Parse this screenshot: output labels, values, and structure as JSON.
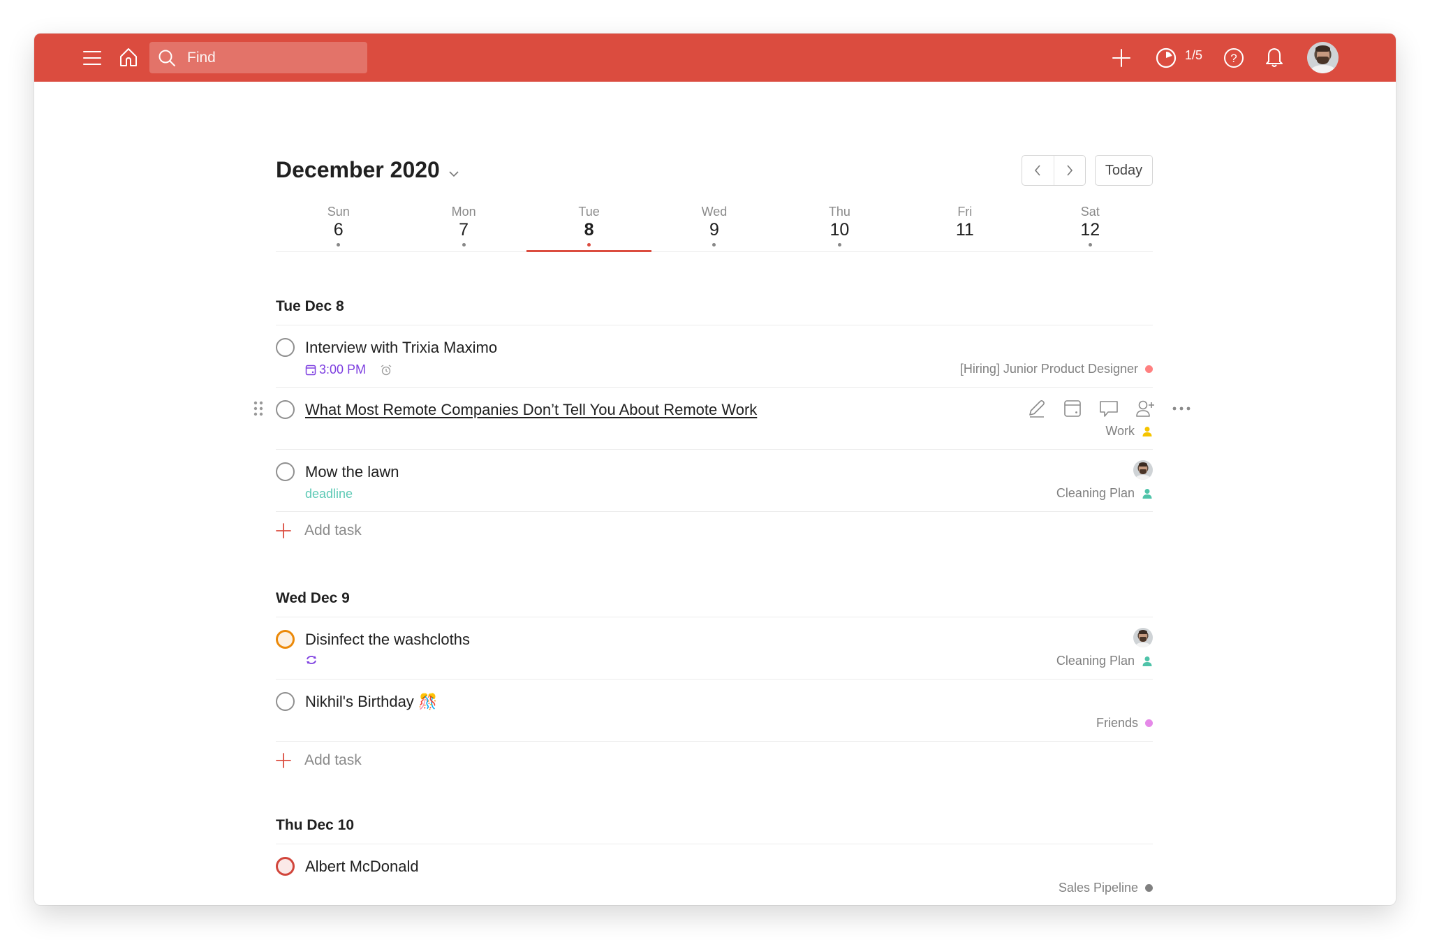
{
  "topbar": {
    "menu_icon": "hamburger-menu-icon",
    "home_icon": "home-icon",
    "search": {
      "placeholder": "Find",
      "value": ""
    },
    "add_icon": "plus-icon",
    "karma": {
      "icon": "productivity-pie-icon",
      "label": "1/5"
    },
    "help_icon": "help-icon",
    "notifications_icon": "bell-icon",
    "avatar": "user-avatar",
    "accent": "#db4c3f"
  },
  "header": {
    "month_title": "December 2020",
    "prev_label": "Previous week",
    "next_label": "Next week",
    "today_label": "Today"
  },
  "week": [
    {
      "name": "Sun",
      "num": "6",
      "has_tasks": true,
      "active": false
    },
    {
      "name": "Mon",
      "num": "7",
      "has_tasks": true,
      "active": false
    },
    {
      "name": "Tue",
      "num": "8",
      "has_tasks": true,
      "active": true
    },
    {
      "name": "Wed",
      "num": "9",
      "has_tasks": true,
      "active": false
    },
    {
      "name": "Thu",
      "num": "10",
      "has_tasks": true,
      "active": false
    },
    {
      "name": "Fri",
      "num": "11",
      "has_tasks": false,
      "active": false
    },
    {
      "name": "Sat",
      "num": "12",
      "has_tasks": true,
      "active": false
    }
  ],
  "sections": [
    {
      "title": "Tue Dec 8",
      "tasks": [
        {
          "title": "Interview with Trixia Maximo",
          "priority": "none",
          "due": "3:00 PM",
          "due_color": "#7d3ee0",
          "reminder": true,
          "project": "[Hiring] Junior Product Designer",
          "project_color": "#ff8080",
          "project_type": "dot"
        },
        {
          "title": "What Most Remote Companies Don’t Tell You About Remote Work",
          "priority": "none",
          "link": true,
          "hovered": true,
          "project": "Work",
          "project_color": "#f5c400",
          "project_type": "shared",
          "actions": [
            "Edit",
            "Schedule",
            "Comment",
            "Assign",
            "More actions"
          ]
        },
        {
          "title": "Mow the lawn",
          "priority": "none",
          "label": "deadline",
          "label_color": "#5cc9b5",
          "assignee": true,
          "project": "Cleaning Plan",
          "project_color": "#4fc3a9",
          "project_type": "shared"
        }
      ],
      "add_label": "Add task"
    },
    {
      "title": "Wed Dec 9",
      "tasks": [
        {
          "title": "Disinfect the washcloths",
          "priority": "p2",
          "recurring": true,
          "assignee": true,
          "project": "Cleaning Plan",
          "project_color": "#4fc3a9",
          "project_type": "shared"
        },
        {
          "title": "Nikhil's Birthday",
          "emoji": "🎊",
          "priority": "none",
          "project": "Friends",
          "project_color": "#e589e8",
          "project_type": "dot"
        }
      ],
      "add_label": "Add task"
    },
    {
      "title": "Thu Dec 10",
      "tasks": [
        {
          "title": "Albert McDonald",
          "priority": "p1",
          "project": "Sales Pipeline",
          "project_color": "#808080",
          "project_type": "dot"
        }
      ],
      "add_label": "Add task"
    }
  ]
}
